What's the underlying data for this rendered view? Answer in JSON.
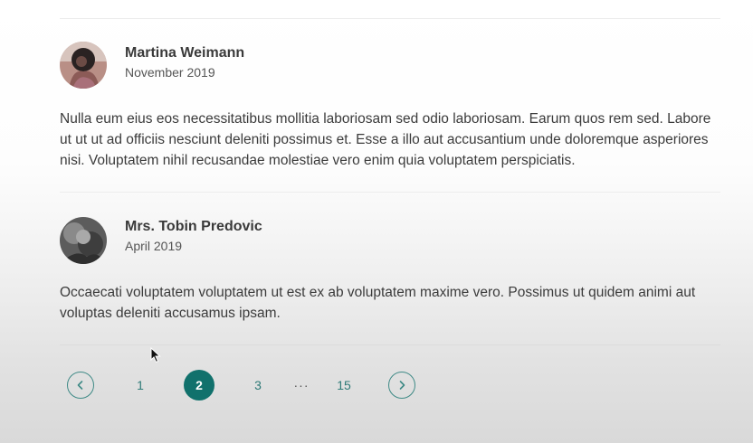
{
  "reviews": [
    {
      "author": "Martina Weimann",
      "date": "November 2019",
      "text": "Nulla eum eius eos necessitatibus mollitia laboriosam sed odio laboriosam. Earum quos rem sed. Labore ut ut ut ad officiis nesciunt deleniti possimus et. Esse a illo aut accusantium unde doloremque asperiores nisi. Voluptatem nihil recusandae molestiae vero enim quia voluptatem perspiciatis."
    },
    {
      "author": "Mrs. Tobin Predovic",
      "date": "April 2019",
      "text": "Occaecati voluptatem voluptatem ut est ex ab voluptatem maxime vero. Possimus ut quidem animi aut voluptas deleniti accusamus ipsam."
    }
  ],
  "pagination": {
    "prev_icon": "chevron-left-icon",
    "next_icon": "chevron-right-icon",
    "pages": [
      "1",
      "2",
      "3",
      "···",
      "15"
    ],
    "current": "2",
    "accent_color": "#11716c"
  }
}
